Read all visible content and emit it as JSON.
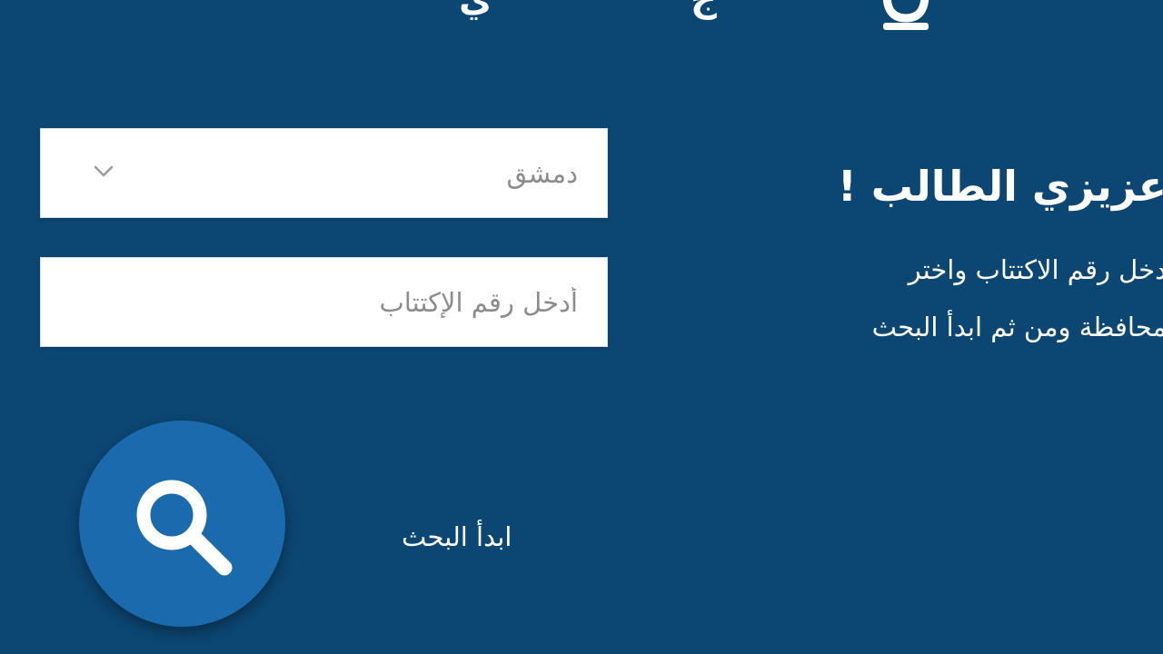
{
  "header": {
    "title_fragment_left": "ي",
    "title_fragment_right": "ج",
    "logo_icon": "bell-icon"
  },
  "form": {
    "governorate_select": {
      "selected": "دمشق",
      "icon": "chevron-down-icon"
    },
    "exam_number_input": {
      "value": "",
      "placeholder": "أدخل رقم الإكتتاب"
    },
    "search_button": {
      "icon": "search-icon",
      "label": "ابدأ البحث"
    }
  },
  "intro": {
    "greeting": "عزيزي الطالب !",
    "line_1": "دخل رقم الاكتتاب واختر",
    "line_2": "محافظة ومن ثم ابدأ البحث"
  },
  "colors": {
    "background": "#0c4672",
    "button": "#1a6aad",
    "field": "#ffffff",
    "placeholder": "#8c8c8c"
  }
}
